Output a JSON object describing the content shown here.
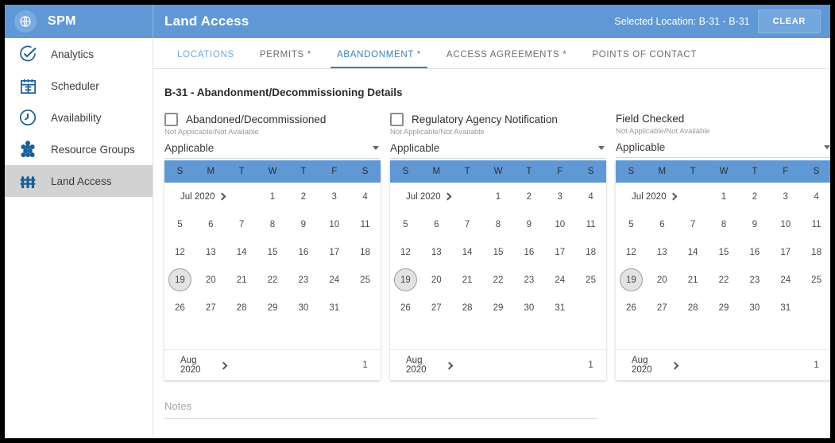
{
  "brand": {
    "title": "SPM",
    "icon": "globe-icon"
  },
  "header": {
    "app_title": "Land Access",
    "selected_location": "Selected Location: B-31 - B-31",
    "clear_label": "CLEAR",
    "bg_color": "#6098d6"
  },
  "sidebar": {
    "items": [
      {
        "label": "Analytics",
        "icon": "check-circle-icon",
        "active": false
      },
      {
        "label": "Scheduler",
        "icon": "calendar-icon",
        "active": false
      },
      {
        "label": "Availability",
        "icon": "clock-icon",
        "active": false
      },
      {
        "label": "Resource Groups",
        "icon": "group-dots-icon",
        "active": false
      },
      {
        "label": "Land Access",
        "icon": "fence-icon",
        "active": true
      }
    ]
  },
  "tabs": [
    {
      "label": "LOCATIONS",
      "active": false,
      "first": true
    },
    {
      "label": "PERMITS *",
      "active": false,
      "first": false
    },
    {
      "label": "ABANDONMENT *",
      "active": true,
      "first": false
    },
    {
      "label": "ACCESS AGREEMENTS *",
      "active": false,
      "first": false
    },
    {
      "label": "POINTS OF CONTACT",
      "active": false,
      "first": false
    }
  ],
  "page_title": "B-31 - Abandonment/Decommissioning Details",
  "columns": [
    {
      "has_checkbox": true,
      "checkbox_checked": false,
      "label": "Abandoned/Decommissioned",
      "sublabel": "Not Applicable/Not Available",
      "select_value": "Applicable"
    },
    {
      "has_checkbox": true,
      "checkbox_checked": false,
      "label": "Regulatory Agency Notification",
      "sublabel": "Not Applicable/Not Available",
      "select_value": "Applicable"
    },
    {
      "has_checkbox": false,
      "checkbox_checked": false,
      "label": "Field Checked",
      "sublabel": "Not Applicable/Not Available",
      "select_value": "Applicable"
    }
  ],
  "calendar": {
    "dow": [
      "S",
      "M",
      "T",
      "W",
      "T",
      "F",
      "S"
    ],
    "month_label": "Jul 2020",
    "next_month_label": "Aug 2020",
    "lead_blank_days": 3,
    "days_in_month": 31,
    "highlighted_day": 19,
    "next_month_first_day": "1",
    "next_month_first_col": 6,
    "header_bg": "#6098d6"
  },
  "notes": {
    "placeholder": "Notes",
    "value": ""
  }
}
